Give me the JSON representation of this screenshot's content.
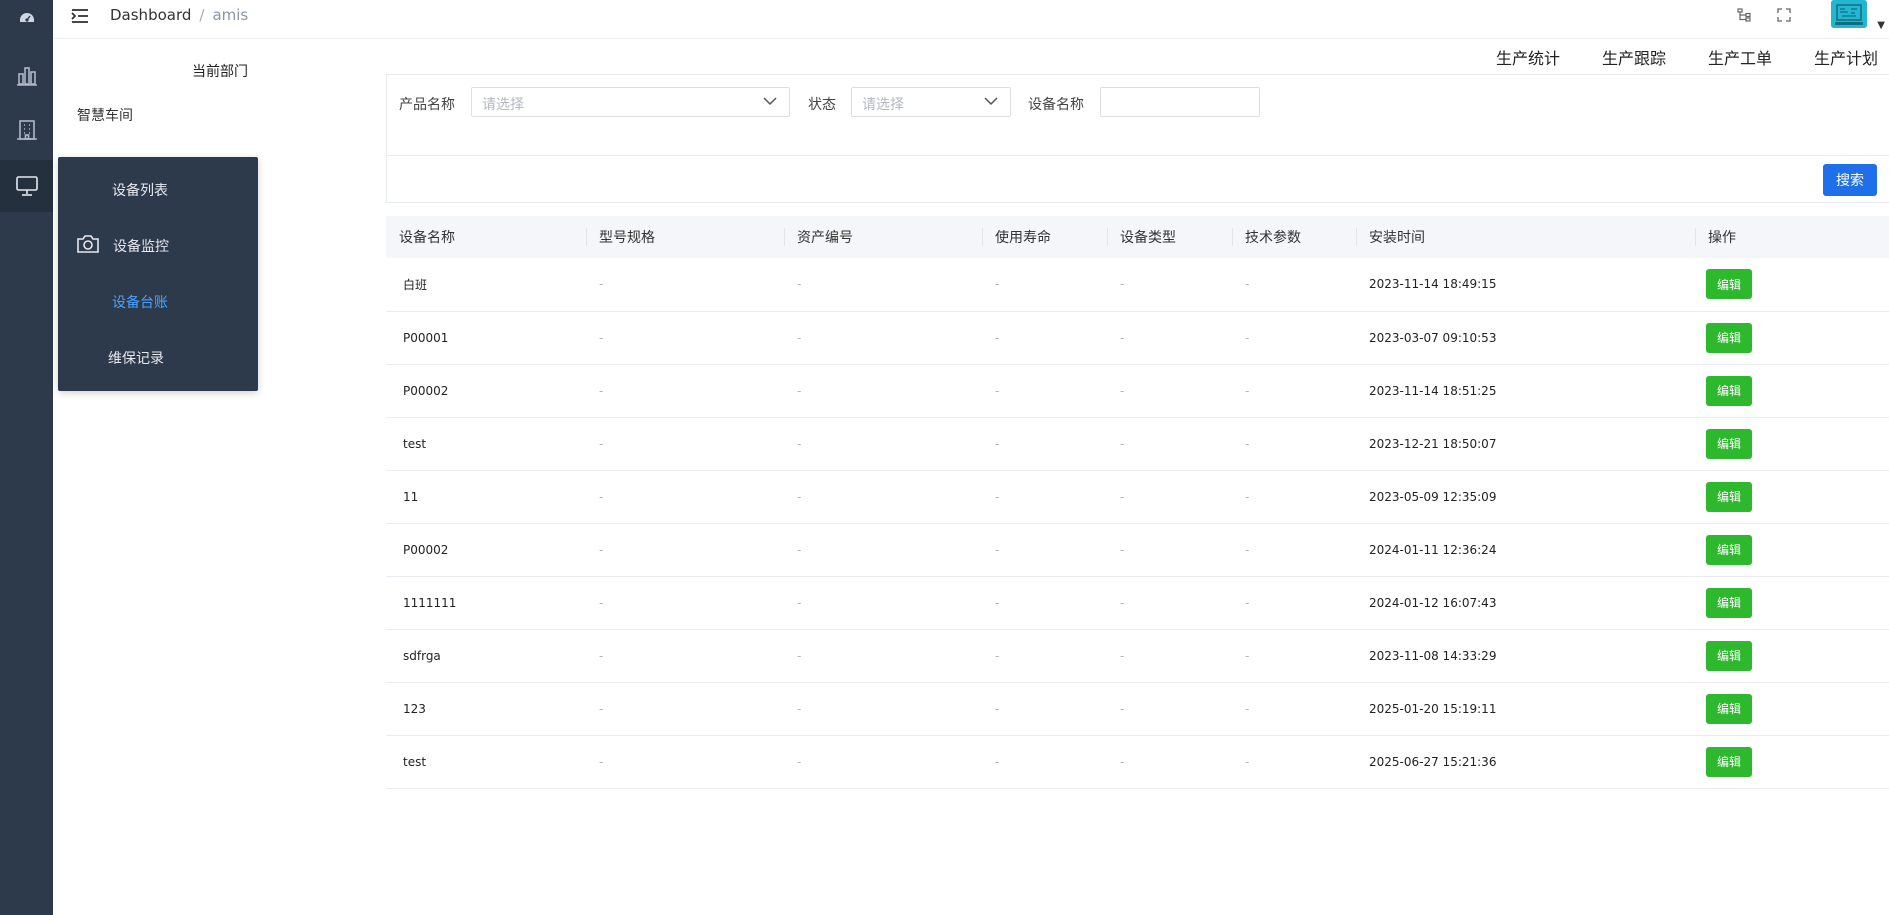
{
  "header": {
    "breadcrumb_home": "Dashboard",
    "breadcrumb_sep": "/",
    "breadcrumb_current": "amis"
  },
  "department": {
    "title": "当前部门",
    "item": "智慧车间"
  },
  "flyout_menu": {
    "items": [
      {
        "label": "设备列表"
      },
      {
        "label": "设备监控",
        "icon": "camera-icon"
      },
      {
        "label": "设备台账"
      },
      {
        "label": "维保记录"
      }
    ]
  },
  "top_tabs": [
    "生产统计",
    "生产跟踪",
    "生产工单",
    "生产计划"
  ],
  "search": {
    "product_label": "产品名称",
    "product_placeholder": "请选择",
    "status_label": "状态",
    "status_placeholder": "请选择",
    "device_label": "设备名称",
    "device_value": "",
    "search_button": "搜索"
  },
  "table": {
    "columns": [
      "设备名称",
      "型号规格",
      "资产编号",
      "使用寿命",
      "设备类型",
      "技术参数",
      "安装时间",
      "操作"
    ],
    "edit_label": "编辑",
    "rows": [
      {
        "name": "白班",
        "model": "-",
        "asset": "-",
        "life": "-",
        "type": "-",
        "params": "-",
        "time": "2023-11-14 18:49:15"
      },
      {
        "name": "P00001",
        "model": "-",
        "asset": "-",
        "life": "-",
        "type": "-",
        "params": "-",
        "time": "2023-03-07 09:10:53"
      },
      {
        "name": "P00002",
        "model": "-",
        "asset": "-",
        "life": "-",
        "type": "-",
        "params": "-",
        "time": "2023-11-14 18:51:25"
      },
      {
        "name": "test",
        "model": "-",
        "asset": "-",
        "life": "-",
        "type": "-",
        "params": "-",
        "time": "2023-12-21 18:50:07"
      },
      {
        "name": "11",
        "model": "-",
        "asset": "-",
        "life": "-",
        "type": "-",
        "params": "-",
        "time": "2023-05-09 12:35:09"
      },
      {
        "name": "P00002",
        "model": "-",
        "asset": "-",
        "life": "-",
        "type": "-",
        "params": "-",
        "time": "2024-01-11 12:36:24"
      },
      {
        "name": "1111111",
        "model": "-",
        "asset": "-",
        "life": "-",
        "type": "-",
        "params": "-",
        "time": "2024-01-12 16:07:43"
      },
      {
        "name": "sdfrga",
        "model": "-",
        "asset": "-",
        "life": "-",
        "type": "-",
        "params": "-",
        "time": "2023-11-08 14:33:29"
      },
      {
        "name": "123",
        "model": "-",
        "asset": "-",
        "life": "-",
        "type": "-",
        "params": "-",
        "time": "2025-01-20 15:19:11"
      },
      {
        "name": "test",
        "model": "-",
        "asset": "-",
        "life": "-",
        "type": "-",
        "params": "-",
        "time": "2025-06-27 15:21:36"
      }
    ]
  },
  "colors": {
    "sidebar_bg": "#2d3a4b",
    "active_link": "#4aa3ff",
    "primary_button": "#1f6feb",
    "edit_button": "#2eb82e"
  }
}
